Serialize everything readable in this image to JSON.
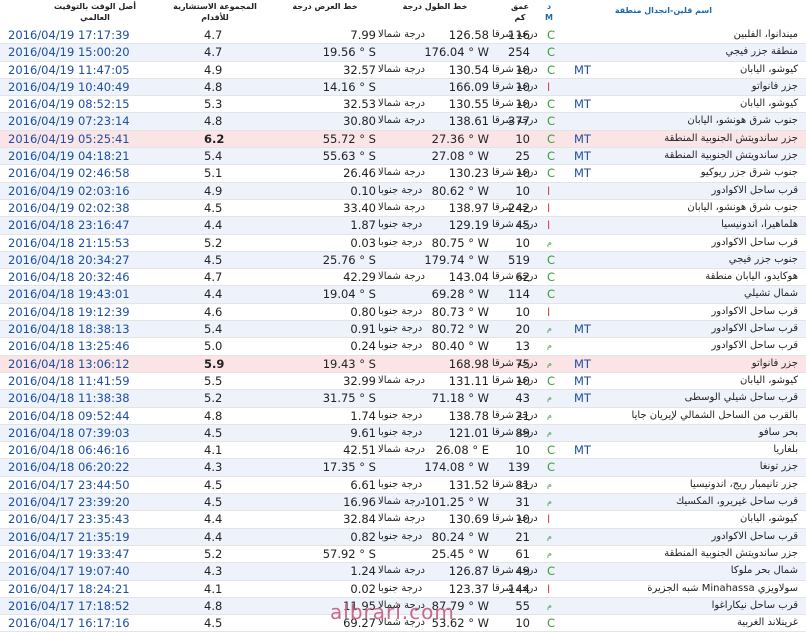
{
  "header": {
    "time": "أصل الوقت بالتوقيت العالمي",
    "magnitude": "المجموعة الاستشارية للأقدام",
    "latitude": "خط العرض درجة",
    "longitude": "خط الطول درجة",
    "depth": "عمق كم",
    "dm": "د M",
    "region": "اسم قلين-انجدال منطقة"
  },
  "rows": [
    {
      "time": "2016/04/19 17:17:39",
      "mag": "4.7",
      "lat": "7.99",
      "latu": "درجة شمالا",
      "lon": "126.58",
      "lonu": "درجة شرقا",
      "dep": "116",
      "src": "C",
      "mt": "",
      "region": "ميندانوا، الفلبين",
      "hl": false
    },
    {
      "time": "2016/04/19 15:00:20",
      "mag": "4.7",
      "lat": "19.56 ° S",
      "latu": "",
      "lon": "176.04 ° W",
      "lonu": "",
      "dep": "254",
      "src": "C",
      "mt": "",
      "region": "منطقة جزر فيجي",
      "hl": false
    },
    {
      "time": "2016/04/19 11:47:05",
      "mag": "4.9",
      "lat": "32.57",
      "latu": "درجة شمالا",
      "lon": "130.54",
      "lonu": "درجة شرقا",
      "dep": "10",
      "src": "C",
      "mt": "MT",
      "region": "كيوشو، اليابان",
      "hl": false
    },
    {
      "time": "2016/04/19 10:40:49",
      "mag": "4.8",
      "lat": "14.16 ° S",
      "latu": "",
      "lon": "166.09",
      "lonu": "درجة شرقا",
      "dep": "10",
      "src": "ا",
      "mt": "",
      "region": "جزر فانواتو",
      "hl": false
    },
    {
      "time": "2016/04/19 08:52:15",
      "mag": "5.3",
      "lat": "32.53",
      "latu": "درجة شمالا",
      "lon": "130.55",
      "lonu": "درجة شرقا",
      "dep": "10",
      "src": "C",
      "mt": "MT",
      "region": "كيوشو، اليابان",
      "hl": false
    },
    {
      "time": "2016/04/19 07:23:14",
      "mag": "4.8",
      "lat": "30.80",
      "latu": "درجة شمالا",
      "lon": "138.61",
      "lonu": "درجة شرقا",
      "dep": "377",
      "src": "C",
      "mt": "",
      "region": "جنوب شرق هونشو، اليابان",
      "hl": false
    },
    {
      "time": "2016/04/19 05:25:41",
      "mag": "6.2",
      "lat": "55.72 ° S",
      "latu": "",
      "lon": "27.36 ° W",
      "lonu": "",
      "dep": "10",
      "src": "C",
      "mt": "MT",
      "region": "جزر ساندويتش الجنوبية المنطقة",
      "hl": true
    },
    {
      "time": "2016/04/19 04:18:21",
      "mag": "5.4",
      "lat": "55.63 ° S",
      "latu": "",
      "lon": "27.08 ° W",
      "lonu": "",
      "dep": "25",
      "src": "C",
      "mt": "MT",
      "region": "جزر ساندويتش الجنوبية المنطقة",
      "hl": false
    },
    {
      "time": "2016/04/19 02:46:58",
      "mag": "5.1",
      "lat": "26.46",
      "latu": "درجة شمالا",
      "lon": "130.23",
      "lonu": "درجة شرقا",
      "dep": "10",
      "src": "C",
      "mt": "MT",
      "region": "جنوب شرق جزر ريوكيو",
      "hl": false
    },
    {
      "time": "2016/04/19 02:03:16",
      "mag": "4.9",
      "lat": "0.10",
      "latu": "درجة جنوبا",
      "lon": "80.62 ° W",
      "lonu": "",
      "dep": "10",
      "src": "ا",
      "mt": "",
      "region": "قرب ساحل الاكوادور",
      "hl": false
    },
    {
      "time": "2016/04/19 02:02:38",
      "mag": "4.5",
      "lat": "33.40",
      "latu": "درجة شمالا",
      "lon": "138.97",
      "lonu": "درجة شرقا",
      "dep": "242",
      "src": "ا",
      "mt": "",
      "region": "جنوب شرق هونشو، اليابان",
      "hl": false
    },
    {
      "time": "2016/04/18 23:16:47",
      "mag": "4.4",
      "lat": "1.87",
      "latu": "درجة جنوبا",
      "lon": "129.19",
      "lonu": "درجة شرقا",
      "dep": "45",
      "src": "ا",
      "mt": "",
      "region": "هلماهيرا، اندونيسيا",
      "hl": false
    },
    {
      "time": "2016/04/18 21:15:53",
      "mag": "5.2",
      "lat": "0.03",
      "latu": "درجة جنوبا",
      "lon": "80.75 ° W",
      "lonu": "",
      "dep": "10",
      "src": "م",
      "mt": "",
      "region": "قرب ساحل الاكوادور",
      "hl": false
    },
    {
      "time": "2016/04/18 20:34:27",
      "mag": "4.5",
      "lat": "25.76 ° S",
      "latu": "",
      "lon": "179.74 ° W",
      "lonu": "",
      "dep": "519",
      "src": "C",
      "mt": "",
      "region": "جنوب جزر فيجي",
      "hl": false
    },
    {
      "time": "2016/04/18 20:32:46",
      "mag": "4.7",
      "lat": "42.29",
      "latu": "درجة شمالا",
      "lon": "143.04",
      "lonu": "درجة شرقا",
      "dep": "62",
      "src": "C",
      "mt": "",
      "region": "هوكايدو، اليابان منطقة",
      "hl": false
    },
    {
      "time": "2016/04/18 19:43:01",
      "mag": "4.4",
      "lat": "19.04 ° S",
      "latu": "",
      "lon": "69.28 ° W",
      "lonu": "",
      "dep": "114",
      "src": "C",
      "mt": "",
      "region": "شمال تشيلي",
      "hl": false
    },
    {
      "time": "2016/04/18 19:12:39",
      "mag": "4.6",
      "lat": "0.80",
      "latu": "درجة جنوبا",
      "lon": "80.73 ° W",
      "lonu": "",
      "dep": "10",
      "src": "ا",
      "mt": "",
      "region": "قرب ساحل الاكوادور",
      "hl": false
    },
    {
      "time": "2016/04/18 18:38:13",
      "mag": "5.4",
      "lat": "0.91",
      "latu": "درجة جنوبا",
      "lon": "80.72 ° W",
      "lonu": "",
      "dep": "20",
      "src": "م",
      "mt": "MT",
      "region": "قرب ساحل الاكوادور",
      "hl": false
    },
    {
      "time": "2016/04/18 13:25:46",
      "mag": "5.0",
      "lat": "0.24",
      "latu": "درجة جنوبا",
      "lon": "80.40 ° W",
      "lonu": "",
      "dep": "13",
      "src": "م",
      "mt": "",
      "region": "قرب ساحل الاكوادور",
      "hl": false
    },
    {
      "time": "2016/04/18 13:06:12",
      "mag": "5.9",
      "lat": "19.43 ° S",
      "latu": "",
      "lon": "168.98",
      "lonu": "درجة شرقا",
      "dep": "75",
      "src": "م",
      "mt": "MT",
      "region": "جزر فانواتو",
      "hl": true
    },
    {
      "time": "2016/04/18 11:41:59",
      "mag": "5.5",
      "lat": "32.99",
      "latu": "درجة شمالا",
      "lon": "131.11",
      "lonu": "درجة شرقا",
      "dep": "10",
      "src": "C",
      "mt": "MT",
      "region": "كيوشو، اليابان",
      "hl": false
    },
    {
      "time": "2016/04/18 11:38:38",
      "mag": "5.2",
      "lat": "31.75 ° S",
      "latu": "",
      "lon": "71.18 ° W",
      "lonu": "",
      "dep": "43",
      "src": "م",
      "mt": "MT",
      "region": "قرب ساحل شيلي الوسطى",
      "hl": false
    },
    {
      "time": "2016/04/18 09:52:44",
      "mag": "4.8",
      "lat": "1.74",
      "latu": "درجة جنوبا",
      "lon": "138.78",
      "lonu": "درجة شرقا",
      "dep": "21",
      "src": "م",
      "mt": "",
      "region": "بالقرب من الساحل الشمالي لإيريان جايا",
      "hl": false
    },
    {
      "time": "2016/04/18 07:39:03",
      "mag": "4.5",
      "lat": "9.61",
      "latu": "درجة جنوبا",
      "lon": "121.01",
      "lonu": "درجة شرقا",
      "dep": "89",
      "src": "م",
      "mt": "",
      "region": "بحر سافو",
      "hl": false
    },
    {
      "time": "2016/04/18 06:46:16",
      "mag": "4.1",
      "lat": "42.51",
      "latu": "درجة شمالا",
      "lon": "26.08 ° E",
      "lonu": "",
      "dep": "10",
      "src": "C",
      "mt": "MT",
      "region": "بلغاريا",
      "hl": false
    },
    {
      "time": "2016/04/18 06:20:22",
      "mag": "4.3",
      "lat": "17.35 ° S",
      "latu": "",
      "lon": "174.08 ° W",
      "lonu": "",
      "dep": "139",
      "src": "C",
      "mt": "",
      "region": "جزر تونغا",
      "hl": false
    },
    {
      "time": "2016/04/17 23:44:50",
      "mag": "4.5",
      "lat": "6.61",
      "latu": "درجة جنوبا",
      "lon": "131.52",
      "lonu": "درجة شرقا",
      "dep": "81",
      "src": "م",
      "mt": "",
      "region": "جزر تانيمبار ريج، اندونيسيا",
      "hl": false
    },
    {
      "time": "2016/04/17 23:39:20",
      "mag": "4.5",
      "lat": "16.96",
      "latu": "درجة شمالا",
      "lon": "101.25 ° W",
      "lonu": "",
      "dep": "31",
      "src": "م",
      "mt": "",
      "region": "قرب ساحل غيريرو، المكسيك",
      "hl": false
    },
    {
      "time": "2016/04/17 23:35:43",
      "mag": "4.4",
      "lat": "32.84",
      "latu": "درجة شمالا",
      "lon": "130.69",
      "lonu": "درجة شرقا",
      "dep": "10",
      "src": "ا",
      "mt": "",
      "region": "كيوشو، اليابان",
      "hl": false
    },
    {
      "time": "2016/04/17 21:35:19",
      "mag": "4.4",
      "lat": "0.82",
      "latu": "درجة جنوبا",
      "lon": "80.24 ° W",
      "lonu": "",
      "dep": "21",
      "src": "م",
      "mt": "",
      "region": "قرب ساحل الاكوادور",
      "hl": false
    },
    {
      "time": "2016/04/17 19:33:47",
      "mag": "5.2",
      "lat": "57.92 ° S",
      "latu": "",
      "lon": "25.45 ° W",
      "lonu": "",
      "dep": "61",
      "src": "م",
      "mt": "",
      "region": "جزر ساندويتش الجنوبية المنطقة",
      "hl": false
    },
    {
      "time": "2016/04/17 19:07:40",
      "mag": "4.3",
      "lat": "1.24",
      "latu": "درجة شمالا",
      "lon": "126.87",
      "lonu": "درجة شرقا",
      "dep": "49",
      "src": "C",
      "mt": "",
      "region": "شمال بحر ملوكا",
      "hl": false
    },
    {
      "time": "2016/04/17 18:24:21",
      "mag": "4.1",
      "lat": "0.02",
      "latu": "درجة جنوبا",
      "lon": "123.37",
      "lonu": "درجة شرقا",
      "dep": "144",
      "src": "ا",
      "mt": "",
      "region": "سولاويزي Minahassa شبه الجزيرة",
      "hl": false
    },
    {
      "time": "2016/04/17 17:18:52",
      "mag": "4.8",
      "lat": "11.95",
      "latu": "درجة شمالا",
      "lon": "87.79 ° W",
      "lonu": "",
      "dep": "55",
      "src": "م",
      "mt": "",
      "region": "قرب ساحل نيكاراغوا",
      "hl": false
    },
    {
      "time": "2016/04/17 16:17:16",
      "mag": "4.5",
      "lat": "69.27",
      "latu": "درجة شمالا",
      "lon": "53.62 ° W",
      "lonu": "",
      "dep": "10",
      "src": "C",
      "mt": "",
      "region": "غرينلاند الغربية",
      "hl": false
    }
  ],
  "watermark": "albrari.com"
}
